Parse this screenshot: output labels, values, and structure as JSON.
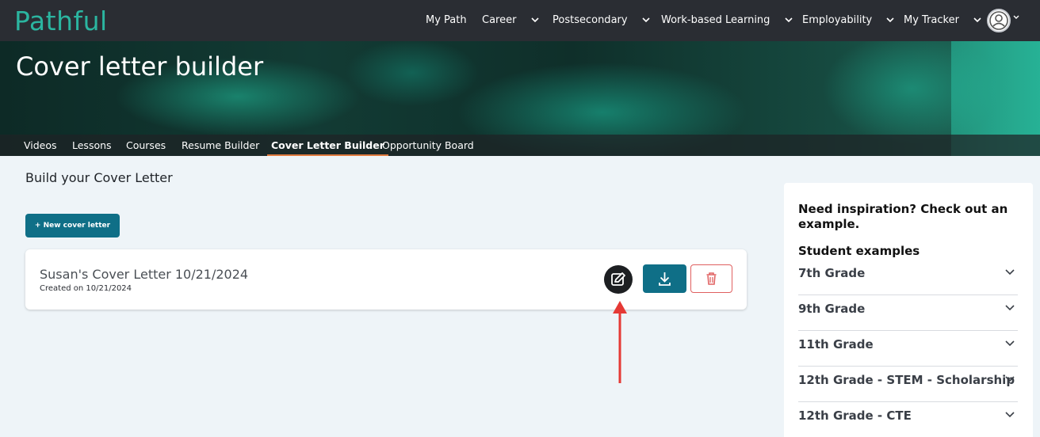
{
  "app": {
    "logo_text": "Pathful"
  },
  "topnav": {
    "items": [
      {
        "label": "My Path",
        "has_dropdown": false
      },
      {
        "label": "Career",
        "has_dropdown": true
      },
      {
        "label": "Postsecondary",
        "has_dropdown": true
      },
      {
        "label": "Work-based Learning",
        "has_dropdown": true
      },
      {
        "label": "Employability",
        "has_dropdown": true
      },
      {
        "label": "My Tracker",
        "has_dropdown": true
      }
    ],
    "avatar_icon": "user-avatar-icon"
  },
  "banner": {
    "title": "Cover letter builder"
  },
  "subnav": {
    "items": [
      {
        "label": "Videos",
        "active": false
      },
      {
        "label": "Lessons",
        "active": false
      },
      {
        "label": "Courses",
        "active": false
      },
      {
        "label": "Resume Builder",
        "active": false
      },
      {
        "label": "Cover Letter Builder",
        "active": true
      },
      {
        "label": "Opportunity Board",
        "active": false
      }
    ]
  },
  "main": {
    "section_title": "Build your Cover Letter",
    "new_button_label": "+ New cover letter",
    "letters": [
      {
        "title": "Susan's Cover Letter 10/21/2024",
        "created": "Created on 10/21/2024",
        "actions": [
          "edit-icon",
          "download-icon",
          "trash-icon"
        ]
      }
    ]
  },
  "panel": {
    "heading": "Need inspiration? Check out an example.",
    "subheading": "Student examples",
    "items": [
      "7th Grade",
      "9th Grade",
      "11th Grade",
      "12th Grade - STEM - Scholarship",
      "12th Grade - CTE"
    ]
  },
  "colors": {
    "nav_bg": "#2a2d33",
    "brand_teal": "#2bb5a0",
    "primary_button": "#0f6f87",
    "active_tab_underline": "#e07a3f",
    "delete_red": "#e06060",
    "annotation_arrow": "#e53935"
  }
}
